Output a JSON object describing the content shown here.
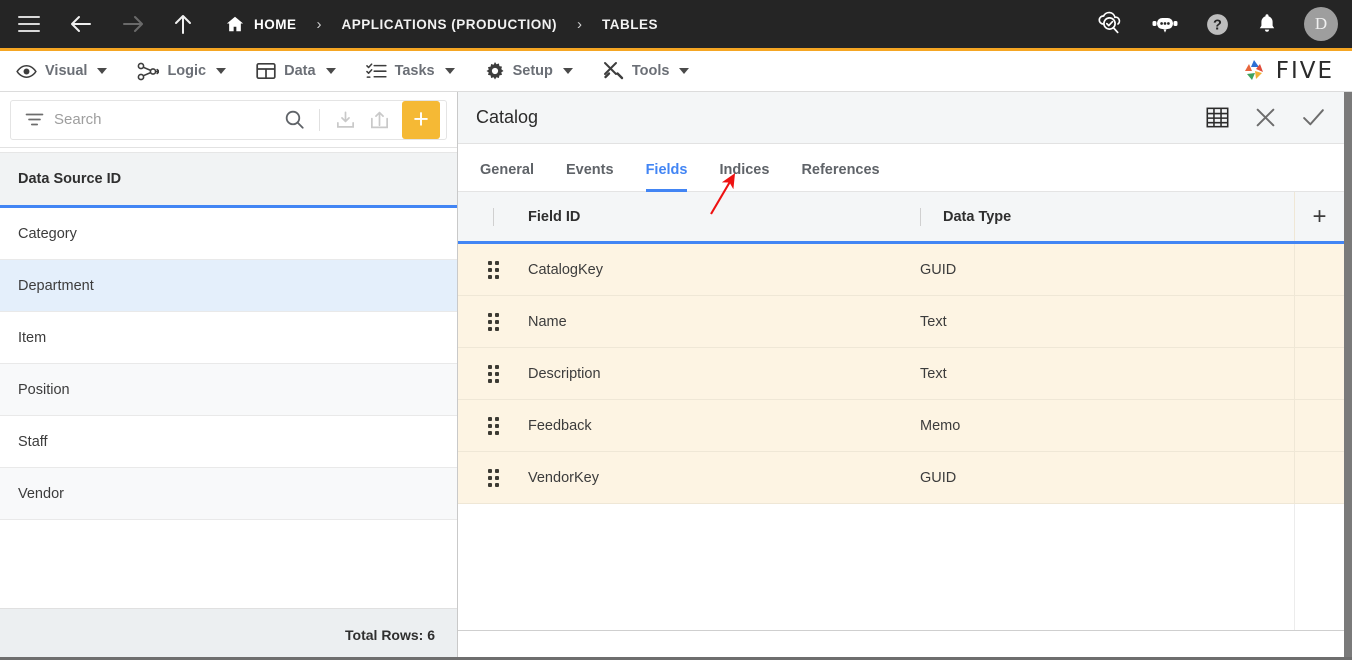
{
  "topbar": {
    "menu_icon": "hamburger-icon",
    "back_icon": "arrow-left-icon",
    "forward_icon": "arrow-right-icon",
    "up_icon": "arrow-up-icon",
    "home_icon": "home-icon",
    "breadcrumbs": [
      {
        "label": "HOME"
      },
      {
        "label": "APPLICATIONS (PRODUCTION)"
      },
      {
        "label": "TABLES"
      }
    ],
    "separator": "›",
    "right_icons": [
      {
        "name": "cloud-check-search-icon"
      },
      {
        "name": "robot-chat-icon"
      },
      {
        "name": "help-icon"
      },
      {
        "name": "notifications-bell-icon"
      }
    ],
    "avatar_initial": "D",
    "background": "#252525"
  },
  "menubar": {
    "accent_color": "#F5A623",
    "items": [
      {
        "label": "Visual",
        "icon": "eye-icon"
      },
      {
        "label": "Logic",
        "icon": "node-graph-icon"
      },
      {
        "label": "Data",
        "icon": "grid-icon"
      },
      {
        "label": "Tasks",
        "icon": "checklist-icon"
      },
      {
        "label": "Setup",
        "icon": "gear-icon"
      },
      {
        "label": "Tools",
        "icon": "wrench-screwdriver-icon"
      }
    ],
    "logo_text": "FIVE"
  },
  "sidebar": {
    "search": {
      "placeholder": "Search",
      "value": ""
    },
    "filter_icon": "filter-icon",
    "search_icon": "search-icon",
    "import_icon": "import-icon",
    "export_icon": "export-icon",
    "add_label": "+",
    "column_header": "Data Source ID",
    "rows": [
      {
        "label": "Category",
        "selected": false
      },
      {
        "label": "Department",
        "selected": true
      },
      {
        "label": "Item",
        "selected": false
      },
      {
        "label": "Position",
        "selected": false
      },
      {
        "label": "Staff",
        "selected": false
      },
      {
        "label": "Vendor",
        "selected": false
      }
    ],
    "footer": "Total Rows: 6"
  },
  "detail": {
    "title": "Catalog",
    "actions": [
      {
        "name": "grid-view-icon"
      },
      {
        "name": "close-icon"
      },
      {
        "name": "confirm-check-icon"
      }
    ],
    "tabs": [
      {
        "label": "General",
        "active": false
      },
      {
        "label": "Events",
        "active": false
      },
      {
        "label": "Fields",
        "active": true
      },
      {
        "label": "Indices",
        "active": false
      },
      {
        "label": "References",
        "active": false
      }
    ],
    "active_tab_color": "#4285F4",
    "grid": {
      "columns": [
        "Field ID",
        "Data Type"
      ],
      "add_column_label": "+",
      "row_background": "#fdf4e3",
      "rows": [
        {
          "field_id": "CatalogKey",
          "data_type": "GUID"
        },
        {
          "field_id": "Name",
          "data_type": "Text"
        },
        {
          "field_id": "Description",
          "data_type": "Text"
        },
        {
          "field_id": "Feedback",
          "data_type": "Memo"
        },
        {
          "field_id": "VendorKey",
          "data_type": "GUID"
        }
      ]
    }
  },
  "annotation": {
    "type": "arrow",
    "color": "#ee1111",
    "points_to": "Indices"
  }
}
